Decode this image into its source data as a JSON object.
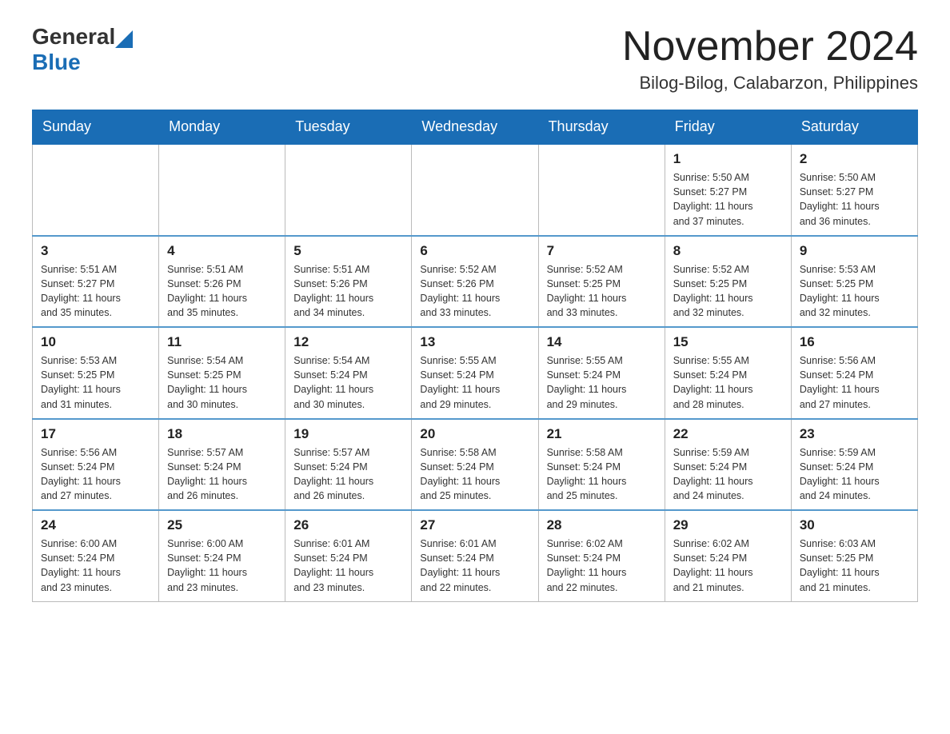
{
  "header": {
    "logo_text_general": "General",
    "logo_text_blue": "Blue",
    "month_title": "November 2024",
    "location": "Bilog-Bilog, Calabarzon, Philippines"
  },
  "weekdays": [
    "Sunday",
    "Monday",
    "Tuesday",
    "Wednesday",
    "Thursday",
    "Friday",
    "Saturday"
  ],
  "weeks": [
    [
      {
        "day": "",
        "info": ""
      },
      {
        "day": "",
        "info": ""
      },
      {
        "day": "",
        "info": ""
      },
      {
        "day": "",
        "info": ""
      },
      {
        "day": "",
        "info": ""
      },
      {
        "day": "1",
        "info": "Sunrise: 5:50 AM\nSunset: 5:27 PM\nDaylight: 11 hours\nand 37 minutes."
      },
      {
        "day": "2",
        "info": "Sunrise: 5:50 AM\nSunset: 5:27 PM\nDaylight: 11 hours\nand 36 minutes."
      }
    ],
    [
      {
        "day": "3",
        "info": "Sunrise: 5:51 AM\nSunset: 5:27 PM\nDaylight: 11 hours\nand 35 minutes."
      },
      {
        "day": "4",
        "info": "Sunrise: 5:51 AM\nSunset: 5:26 PM\nDaylight: 11 hours\nand 35 minutes."
      },
      {
        "day": "5",
        "info": "Sunrise: 5:51 AM\nSunset: 5:26 PM\nDaylight: 11 hours\nand 34 minutes."
      },
      {
        "day": "6",
        "info": "Sunrise: 5:52 AM\nSunset: 5:26 PM\nDaylight: 11 hours\nand 33 minutes."
      },
      {
        "day": "7",
        "info": "Sunrise: 5:52 AM\nSunset: 5:25 PM\nDaylight: 11 hours\nand 33 minutes."
      },
      {
        "day": "8",
        "info": "Sunrise: 5:52 AM\nSunset: 5:25 PM\nDaylight: 11 hours\nand 32 minutes."
      },
      {
        "day": "9",
        "info": "Sunrise: 5:53 AM\nSunset: 5:25 PM\nDaylight: 11 hours\nand 32 minutes."
      }
    ],
    [
      {
        "day": "10",
        "info": "Sunrise: 5:53 AM\nSunset: 5:25 PM\nDaylight: 11 hours\nand 31 minutes."
      },
      {
        "day": "11",
        "info": "Sunrise: 5:54 AM\nSunset: 5:25 PM\nDaylight: 11 hours\nand 30 minutes."
      },
      {
        "day": "12",
        "info": "Sunrise: 5:54 AM\nSunset: 5:24 PM\nDaylight: 11 hours\nand 30 minutes."
      },
      {
        "day": "13",
        "info": "Sunrise: 5:55 AM\nSunset: 5:24 PM\nDaylight: 11 hours\nand 29 minutes."
      },
      {
        "day": "14",
        "info": "Sunrise: 5:55 AM\nSunset: 5:24 PM\nDaylight: 11 hours\nand 29 minutes."
      },
      {
        "day": "15",
        "info": "Sunrise: 5:55 AM\nSunset: 5:24 PM\nDaylight: 11 hours\nand 28 minutes."
      },
      {
        "day": "16",
        "info": "Sunrise: 5:56 AM\nSunset: 5:24 PM\nDaylight: 11 hours\nand 27 minutes."
      }
    ],
    [
      {
        "day": "17",
        "info": "Sunrise: 5:56 AM\nSunset: 5:24 PM\nDaylight: 11 hours\nand 27 minutes."
      },
      {
        "day": "18",
        "info": "Sunrise: 5:57 AM\nSunset: 5:24 PM\nDaylight: 11 hours\nand 26 minutes."
      },
      {
        "day": "19",
        "info": "Sunrise: 5:57 AM\nSunset: 5:24 PM\nDaylight: 11 hours\nand 26 minutes."
      },
      {
        "day": "20",
        "info": "Sunrise: 5:58 AM\nSunset: 5:24 PM\nDaylight: 11 hours\nand 25 minutes."
      },
      {
        "day": "21",
        "info": "Sunrise: 5:58 AM\nSunset: 5:24 PM\nDaylight: 11 hours\nand 25 minutes."
      },
      {
        "day": "22",
        "info": "Sunrise: 5:59 AM\nSunset: 5:24 PM\nDaylight: 11 hours\nand 24 minutes."
      },
      {
        "day": "23",
        "info": "Sunrise: 5:59 AM\nSunset: 5:24 PM\nDaylight: 11 hours\nand 24 minutes."
      }
    ],
    [
      {
        "day": "24",
        "info": "Sunrise: 6:00 AM\nSunset: 5:24 PM\nDaylight: 11 hours\nand 23 minutes."
      },
      {
        "day": "25",
        "info": "Sunrise: 6:00 AM\nSunset: 5:24 PM\nDaylight: 11 hours\nand 23 minutes."
      },
      {
        "day": "26",
        "info": "Sunrise: 6:01 AM\nSunset: 5:24 PM\nDaylight: 11 hours\nand 23 minutes."
      },
      {
        "day": "27",
        "info": "Sunrise: 6:01 AM\nSunset: 5:24 PM\nDaylight: 11 hours\nand 22 minutes."
      },
      {
        "day": "28",
        "info": "Sunrise: 6:02 AM\nSunset: 5:24 PM\nDaylight: 11 hours\nand 22 minutes."
      },
      {
        "day": "29",
        "info": "Sunrise: 6:02 AM\nSunset: 5:24 PM\nDaylight: 11 hours\nand 21 minutes."
      },
      {
        "day": "30",
        "info": "Sunrise: 6:03 AM\nSunset: 5:25 PM\nDaylight: 11 hours\nand 21 minutes."
      }
    ]
  ]
}
